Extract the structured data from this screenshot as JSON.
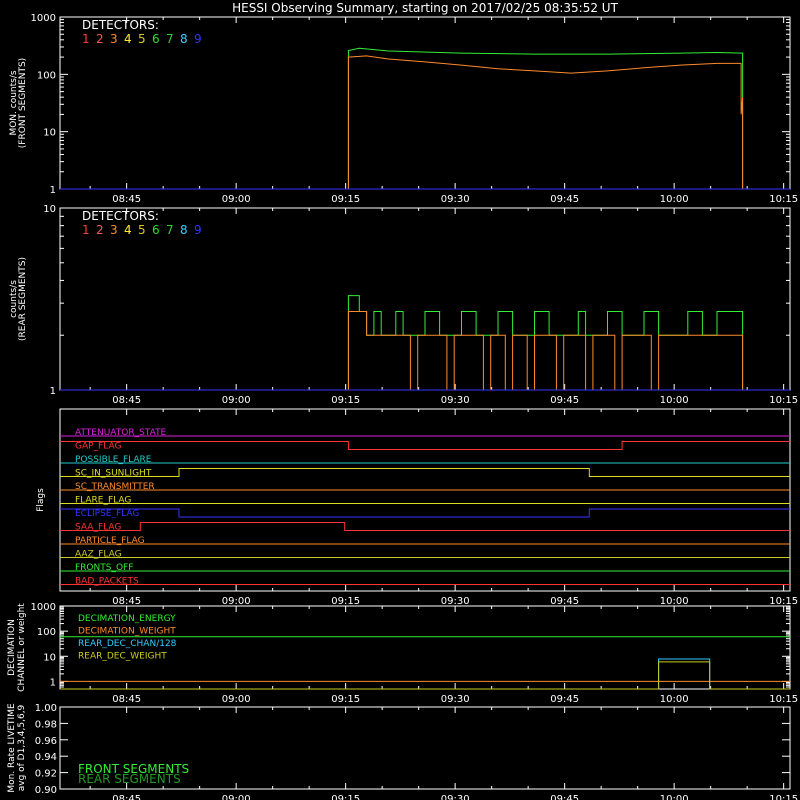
{
  "title": "HESSI Observing Summary, starting on 2017/02/25 08:35:52 UT",
  "time_ticks": [
    "08:45",
    "09:00",
    "09:15",
    "09:30",
    "09:45",
    "10:00",
    "10:15"
  ],
  "detector_legend": {
    "header": "DETECTORS:",
    "items": [
      {
        "label": "1",
        "color": "#ff3b3b"
      },
      {
        "label": "2",
        "color": "#ff5555"
      },
      {
        "label": "3",
        "color": "#ff8a2a"
      },
      {
        "label": "4",
        "color": "#ffee33"
      },
      {
        "label": "5",
        "color": "#d8c820"
      },
      {
        "label": "6",
        "color": "#33dd33"
      },
      {
        "label": "7",
        "color": "#33cc33"
      },
      {
        "label": "8",
        "color": "#33ccff"
      },
      {
        "label": "9",
        "color": "#3333ff"
      }
    ]
  },
  "chart_data": [
    {
      "panel": "front",
      "type": "line",
      "ylabel_line1": "MON. counts/s",
      "ylabel_line2": "(FRONT SEGMENTS)",
      "yscale": "log",
      "ylim": [
        1,
        1000
      ],
      "yticks": [
        1,
        10,
        100,
        1000
      ],
      "xlim_minutes_after_0835": [
        0,
        100
      ],
      "series": [
        {
          "color": "#33ee33",
          "points": [
            [
              0,
              1
            ],
            [
              39.5,
              1
            ],
            [
              39.5,
              260
            ],
            [
              41,
              285
            ],
            [
              45,
              255
            ],
            [
              55,
              235
            ],
            [
              65,
              225
            ],
            [
              75,
              225
            ],
            [
              85,
              235
            ],
            [
              90,
              240
            ],
            [
              93.5,
              235
            ],
            [
              93.5,
              1
            ],
            [
              100,
              1
            ]
          ]
        },
        {
          "color": "#ff8a2a",
          "points": [
            [
              39.5,
              1
            ],
            [
              39.5,
              200
            ],
            [
              42,
              210
            ],
            [
              45,
              185
            ],
            [
              50,
              165
            ],
            [
              55,
              145
            ],
            [
              60,
              125
            ],
            [
              65,
              115
            ],
            [
              70,
              105
            ],
            [
              75,
              115
            ],
            [
              80,
              130
            ],
            [
              85,
              145
            ],
            [
              90,
              155
            ],
            [
              93.3,
              155
            ],
            [
              93.3,
              20
            ],
            [
              93.5,
              40
            ],
            [
              93.5,
              1
            ]
          ]
        },
        {
          "color": "#3333ff",
          "points": [
            [
              0,
              1
            ],
            [
              100,
              1
            ]
          ]
        }
      ]
    },
    {
      "panel": "rear",
      "type": "line",
      "ylabel_line1": "counts/s",
      "ylabel_line2": "(REAR SEGMENTS)",
      "yscale": "log",
      "ylim": [
        1,
        10
      ],
      "yticks": [
        1,
        10
      ],
      "xlim_minutes_after_0835": [
        0,
        100
      ],
      "series": [
        {
          "color": "#33ee33",
          "points": [
            [
              0,
              1
            ],
            [
              39.5,
              1
            ],
            [
              39.5,
              3.3
            ],
            [
              41,
              3.3
            ],
            [
              41,
              2.7
            ],
            [
              42,
              2.7
            ],
            [
              42,
              2
            ],
            [
              43,
              2
            ],
            [
              43,
              2.7
            ],
            [
              44,
              2.7
            ],
            [
              44,
              2
            ],
            [
              46,
              2
            ],
            [
              46,
              2.7
            ],
            [
              47,
              2.7
            ],
            [
              47,
              2
            ],
            [
              50,
              2
            ],
            [
              50,
              2.7
            ],
            [
              52,
              2.7
            ],
            [
              52,
              2
            ],
            [
              55,
              2
            ],
            [
              55,
              2.7
            ],
            [
              57,
              2.7
            ],
            [
              57,
              2
            ],
            [
              60,
              2
            ],
            [
              60,
              2.7
            ],
            [
              62,
              2.7
            ],
            [
              62,
              2
            ],
            [
              65,
              2
            ],
            [
              65,
              2.7
            ],
            [
              67,
              2.7
            ],
            [
              67,
              2
            ],
            [
              71,
              2
            ],
            [
              71,
              2.7
            ],
            [
              72,
              2.7
            ],
            [
              72,
              2
            ],
            [
              75,
              2
            ],
            [
              75,
              2.7
            ],
            [
              77,
              2.7
            ],
            [
              77,
              2
            ],
            [
              80,
              2
            ],
            [
              80,
              2.7
            ],
            [
              82,
              2.7
            ],
            [
              82,
              2
            ],
            [
              86,
              2
            ],
            [
              86,
              2.7
            ],
            [
              88,
              2.7
            ],
            [
              88,
              2
            ],
            [
              90,
              2
            ],
            [
              90,
              2.7
            ],
            [
              93.5,
              2.7
            ],
            [
              93.5,
              1
            ],
            [
              100,
              1
            ]
          ]
        },
        {
          "color": "#ff8a2a",
          "points": [
            [
              39.5,
              1
            ],
            [
              39.5,
              2.7
            ],
            [
              42,
              2.7
            ],
            [
              42,
              2
            ],
            [
              48,
              2
            ],
            [
              48,
              1
            ],
            [
              49,
              1
            ],
            [
              49,
              2
            ],
            [
              53,
              2
            ],
            [
              53,
              1
            ],
            [
              54,
              1
            ],
            [
              54,
              2
            ],
            [
              58,
              2
            ],
            [
              58,
              1
            ],
            [
              59,
              1
            ],
            [
              59,
              2
            ],
            [
              61,
              2
            ],
            [
              61,
              1
            ],
            [
              62,
              1
            ],
            [
              62,
              2
            ],
            [
              64,
              2
            ],
            [
              64,
              1
            ],
            [
              65,
              1
            ],
            [
              65,
              2
            ],
            [
              68,
              2
            ],
            [
              68,
              1
            ],
            [
              69,
              1
            ],
            [
              69,
              2
            ],
            [
              72,
              2
            ],
            [
              72,
              1
            ],
            [
              73,
              1
            ],
            [
              73,
              2
            ],
            [
              76,
              2
            ],
            [
              76,
              1
            ],
            [
              77,
              1
            ],
            [
              77,
              2
            ],
            [
              81,
              2
            ],
            [
              81,
              1
            ],
            [
              82,
              1
            ],
            [
              82,
              2
            ],
            [
              93.5,
              2
            ],
            [
              93.5,
              1
            ]
          ]
        },
        {
          "color": "#3333ff",
          "points": [
            [
              0,
              1
            ],
            [
              100,
              1
            ]
          ]
        }
      ]
    },
    {
      "panel": "flags",
      "type": "line",
      "ylabel": "Flags",
      "rows": [
        {
          "label": "ATTENUATOR_STATE",
          "color": "#dd22dd",
          "steps": [
            [
              0,
              0
            ],
            [
              100,
              0
            ]
          ]
        },
        {
          "label": "GAP_FLAG",
          "color": "#ff3333",
          "steps": [
            [
              0,
              1
            ],
            [
              39.5,
              0
            ],
            [
              77,
              1
            ]
          ]
        },
        {
          "label": "POSSIBLE_FLARE",
          "color": "#22cccc",
          "steps": [
            [
              0,
              0
            ],
            [
              100,
              0
            ]
          ]
        },
        {
          "label": "SC_IN_SUNLIGHT",
          "color": "#dddd22",
          "steps": [
            [
              0,
              0
            ],
            [
              16.3,
              1
            ],
            [
              72.5,
              0
            ]
          ]
        },
        {
          "label": "SC_TRANSMITTER",
          "color": "#ff8a2a",
          "steps": [
            [
              0,
              0
            ],
            [
              100,
              0
            ]
          ]
        },
        {
          "label": "FLARE_FLAG",
          "color": "#dddd22",
          "steps": [
            [
              0,
              0
            ],
            [
              100,
              0
            ]
          ]
        },
        {
          "label": "ECLIPSE_FLAG",
          "color": "#3333ff",
          "steps": [
            [
              0,
              1
            ],
            [
              16.3,
              0
            ],
            [
              72.5,
              1
            ]
          ]
        },
        {
          "label": "SAA_FLAG",
          "color": "#ff3333",
          "steps": [
            [
              0,
              0
            ],
            [
              11,
              1
            ],
            [
              39,
              0
            ]
          ]
        },
        {
          "label": "PARTICLE_FLAG",
          "color": "#ff8a2a",
          "steps": [
            [
              0,
              0
            ],
            [
              100,
              0
            ]
          ]
        },
        {
          "label": "AAZ_FLAG",
          "color": "#cccc22",
          "steps": [
            [
              0,
              0
            ],
            [
              100,
              0
            ]
          ]
        },
        {
          "label": "FRONTS_OFF",
          "color": "#33ee33",
          "steps": [
            [
              0,
              0
            ],
            [
              100,
              0
            ]
          ]
        },
        {
          "label": "BAD_PACKETS",
          "color": "#ff3333",
          "steps": [
            [
              0,
              0
            ],
            [
              100,
              0
            ]
          ]
        }
      ]
    },
    {
      "panel": "decimation",
      "type": "line",
      "ylabel_line1": "DECIMATION",
      "ylabel_line2": "CHANNEL or weight",
      "yscale": "log",
      "ylim": [
        0.5,
        1000
      ],
      "yticks": [
        1,
        10,
        100,
        1000
      ],
      "series": [
        {
          "label": "DECIMATION_ENERGY",
          "color": "#33ee33",
          "points": [
            [
              0,
              60
            ],
            [
              100,
              60
            ]
          ]
        },
        {
          "label": "DECIMATION_WEIGHT",
          "color": "#ff8a2a",
          "points": [
            [
              0,
              1
            ],
            [
              100,
              1
            ]
          ]
        },
        {
          "label": "REAR_DEC_CHAN/128",
          "color": "#33ccff",
          "points": [
            [
              0,
              0.5
            ],
            [
              82,
              0.5
            ],
            [
              82,
              7.8
            ],
            [
              89,
              7.8
            ],
            [
              89,
              0.5
            ],
            [
              100,
              0.5
            ]
          ]
        },
        {
          "label": "REAR_DEC_WEIGHT",
          "color": "#cccc22",
          "points": [
            [
              0,
              0.5
            ],
            [
              82,
              0.5
            ],
            [
              82,
              6
            ],
            [
              89,
              6
            ],
            [
              89,
              0.5
            ],
            [
              100,
              0.5
            ]
          ]
        }
      ]
    },
    {
      "panel": "livetime",
      "type": "line",
      "ylabel_line1": "Mon. Rate LIVETIME",
      "ylabel_line2": "avg of D1,3,4,5,6,9",
      "ylim": [
        0.9,
        1.0
      ],
      "ytick_labels": [
        "0.90",
        "0.92",
        "0.94",
        "0.96",
        "0.98",
        "1.00"
      ],
      "legend": [
        {
          "label": "FRONT SEGMENTS",
          "color": "#33ee33"
        },
        {
          "label": "REAR SEGMENTS",
          "color": "#229922"
        }
      ],
      "series": []
    }
  ]
}
